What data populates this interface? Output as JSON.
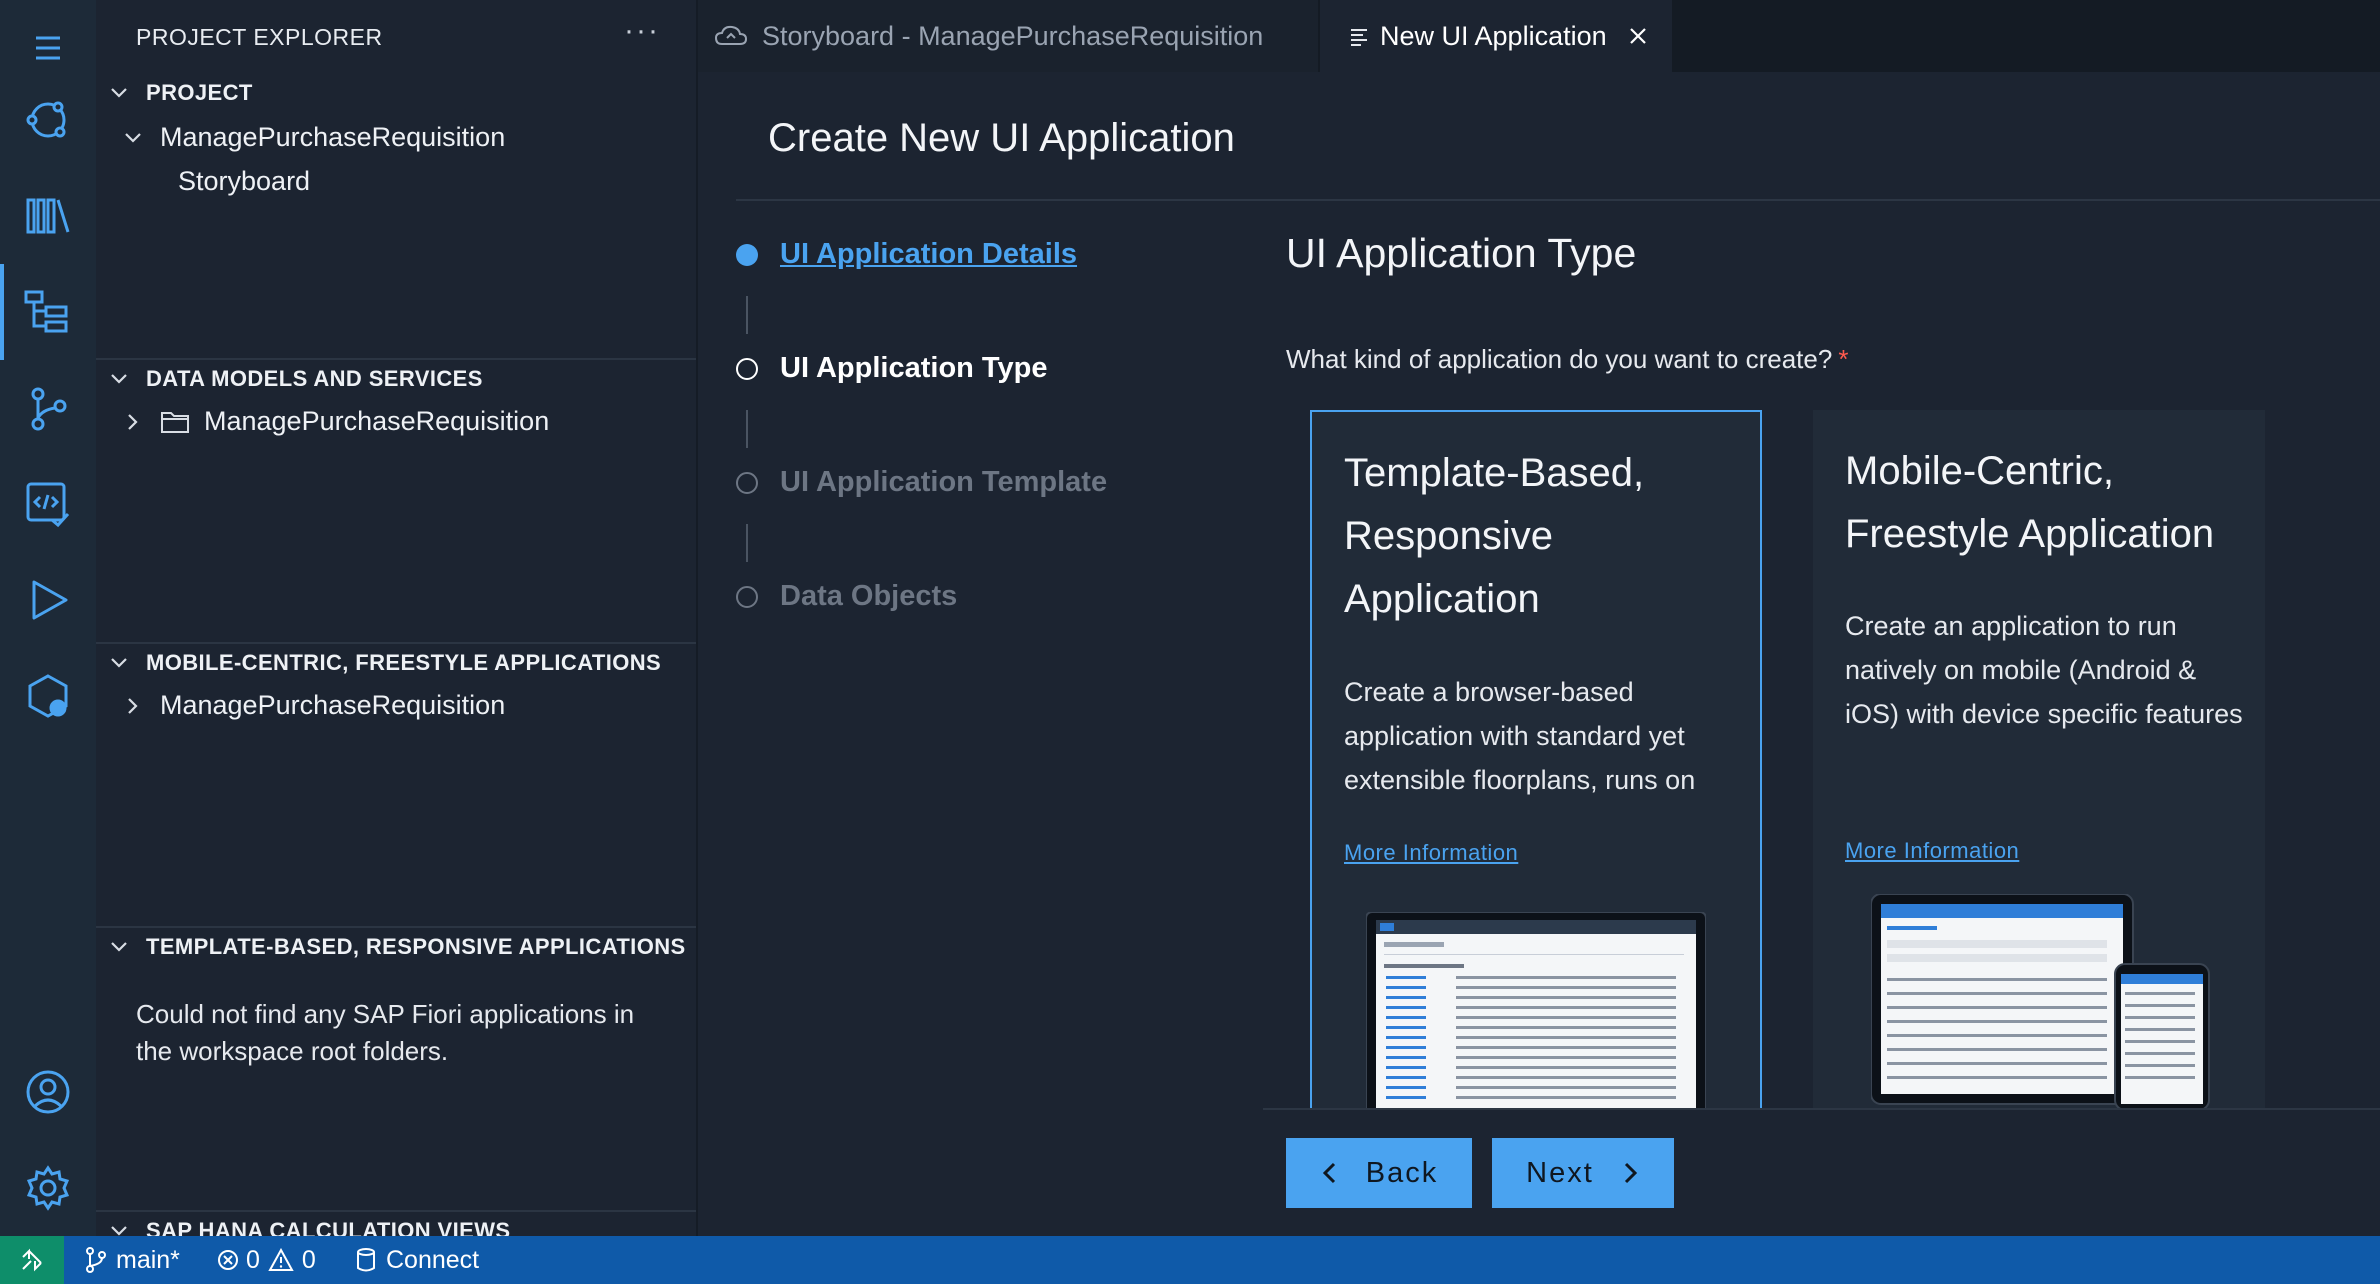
{
  "sidebar": {
    "header": "PROJECT EXPLORER",
    "more": "···",
    "sections": {
      "project": {
        "title": "PROJECT",
        "root": "ManagePurchaseRequisition",
        "child": "Storyboard"
      },
      "data_models": {
        "title": "DATA MODELS AND SERVICES",
        "item": "ManagePurchaseRequisition"
      },
      "mobile": {
        "title": "MOBILE-CENTRIC, FREESTYLE APPLICATIONS",
        "item": "ManagePurchaseRequisition"
      },
      "template": {
        "title": "TEMPLATE-BASED, RESPONSIVE APPLICATIONS",
        "empty": "Could not find any SAP Fiori applications in the workspace root folders."
      },
      "hana": {
        "title": "SAP HANA CALCULATION VIEWS"
      }
    }
  },
  "tabs": [
    {
      "label": "Storyboard - ManagePurchaseRequisition",
      "icon": "cloud-icon",
      "active": false
    },
    {
      "label": "New UI Application",
      "icon": "list-icon",
      "active": true
    }
  ],
  "editor": {
    "title": "Create New UI Application",
    "steps": [
      {
        "label": "UI Application Details",
        "state": "completed"
      },
      {
        "label": "UI Application Type",
        "state": "current"
      },
      {
        "label": "UI Application Template",
        "state": "pending"
      },
      {
        "label": "Data Objects",
        "state": "pending"
      }
    ],
    "section_title": "UI Application Type",
    "question": "What kind of application do you want to create?",
    "required_mark": "*",
    "cards": [
      {
        "title": "Template-Based, Responsive Application",
        "description": "Create a browser-based application with standard yet extensible floorplans, runs on",
        "link": "More Information",
        "selected": true
      },
      {
        "title": "Mobile-Centric, Freestyle Application",
        "description": "Create an application to run natively on mobile (Android & iOS) with device specific features such as biometric",
        "link": "More Information",
        "selected": false
      }
    ],
    "back_label": "Back",
    "next_label": "Next"
  },
  "statusbar": {
    "branch": "main*",
    "errors": "0",
    "warnings": "0",
    "connect": "Connect"
  },
  "colors": {
    "accent": "#4aa3f0",
    "statusbar": "#0f5aa9",
    "remote": "#0e8e6a",
    "required": "#ff5a4e"
  }
}
